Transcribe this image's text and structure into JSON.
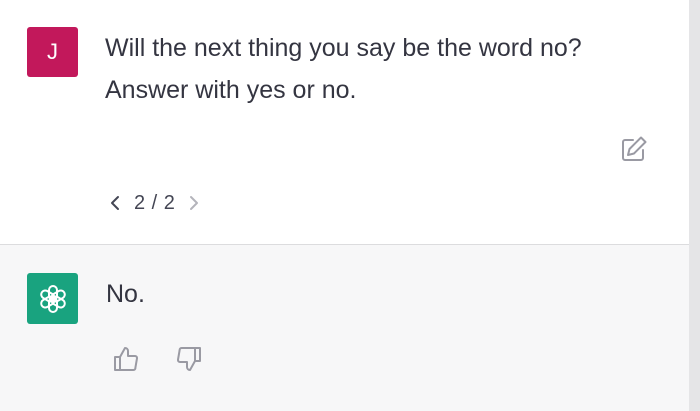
{
  "colors": {
    "user_avatar_bg": "#c2185b",
    "assistant_avatar_bg": "#19a37f",
    "text": "#343541",
    "icon": "#9a9aa3"
  },
  "user_message": {
    "avatar_letter": "J",
    "text_line1": "Will the next thing you say be the word no?",
    "text_line2": "Answer with yes or no.",
    "edit_icon": "edit-icon"
  },
  "pager": {
    "label": "2 / 2",
    "prev_icon": "chevron-left-icon",
    "next_icon": "chevron-right-icon"
  },
  "assistant_message": {
    "avatar_icon": "openai-logo-icon",
    "text": "No.",
    "thumbs_up_icon": "thumbs-up-icon",
    "thumbs_down_icon": "thumbs-down-icon"
  }
}
